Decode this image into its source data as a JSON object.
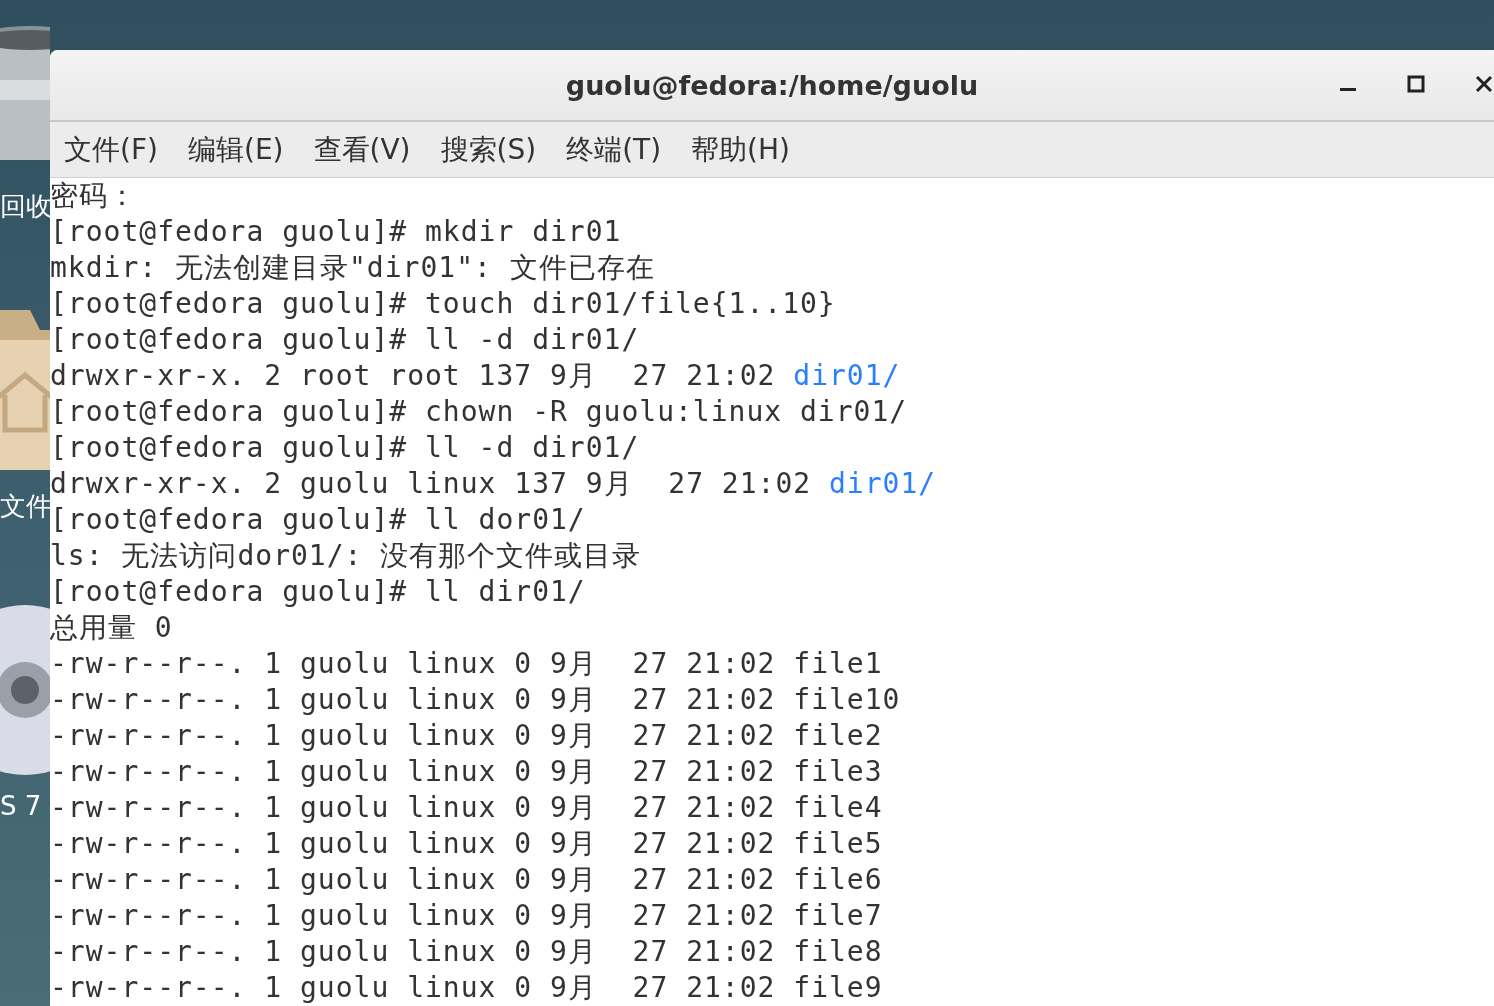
{
  "desktop": {
    "icons": [
      {
        "kind": "trash",
        "label": "回收"
      },
      {
        "kind": "home",
        "label": "文件"
      },
      {
        "kind": "disc",
        "label": "S 7"
      }
    ]
  },
  "window": {
    "title": "guolu@fedora:/home/guolu"
  },
  "menu": [
    "文件(F)",
    "编辑(E)",
    "查看(V)",
    "搜索(S)",
    "终端(T)",
    "帮助(H)"
  ],
  "terminal": {
    "lines": [
      [
        {
          "text": "密码：",
          "kind": "plain"
        }
      ],
      [
        {
          "text": "[root@fedora guolu]# mkdir dir01",
          "kind": "plain"
        }
      ],
      [
        {
          "text": "mkdir: 无法创建目录\"dir01\": 文件已存在",
          "kind": "plain"
        }
      ],
      [
        {
          "text": "[root@fedora guolu]# touch dir01/file{1..10}",
          "kind": "plain"
        }
      ],
      [
        {
          "text": "[root@fedora guolu]# ll -d dir01/",
          "kind": "plain"
        }
      ],
      [
        {
          "text": "drwxr-xr-x. 2 root root 137 9月  27 21:02 ",
          "kind": "plain"
        },
        {
          "text": "dir01/",
          "kind": "dir"
        }
      ],
      [
        {
          "text": "[root@fedora guolu]# chown -R guolu:linux dir01/",
          "kind": "plain"
        }
      ],
      [
        {
          "text": "[root@fedora guolu]# ll -d dir01/",
          "kind": "plain"
        }
      ],
      [
        {
          "text": "drwxr-xr-x. 2 guolu linux 137 9月  27 21:02 ",
          "kind": "plain"
        },
        {
          "text": "dir01/",
          "kind": "dir"
        }
      ],
      [
        {
          "text": "[root@fedora guolu]# ll dor01/",
          "kind": "plain"
        }
      ],
      [
        {
          "text": "ls: 无法访问dor01/: 没有那个文件或目录",
          "kind": "plain"
        }
      ],
      [
        {
          "text": "[root@fedora guolu]# ll dir01/",
          "kind": "plain"
        }
      ],
      [
        {
          "text": "总用量 0",
          "kind": "plain"
        }
      ],
      [
        {
          "text": "-rw-r--r--. 1 guolu linux 0 9月  27 21:02 file1",
          "kind": "plain"
        }
      ],
      [
        {
          "text": "-rw-r--r--. 1 guolu linux 0 9月  27 21:02 file10",
          "kind": "plain"
        }
      ],
      [
        {
          "text": "-rw-r--r--. 1 guolu linux 0 9月  27 21:02 file2",
          "kind": "plain"
        }
      ],
      [
        {
          "text": "-rw-r--r--. 1 guolu linux 0 9月  27 21:02 file3",
          "kind": "plain"
        }
      ],
      [
        {
          "text": "-rw-r--r--. 1 guolu linux 0 9月  27 21:02 file4",
          "kind": "plain"
        }
      ],
      [
        {
          "text": "-rw-r--r--. 1 guolu linux 0 9月  27 21:02 file5",
          "kind": "plain"
        }
      ],
      [
        {
          "text": "-rw-r--r--. 1 guolu linux 0 9月  27 21:02 file6",
          "kind": "plain"
        }
      ],
      [
        {
          "text": "-rw-r--r--. 1 guolu linux 0 9月  27 21:02 file7",
          "kind": "plain"
        }
      ],
      [
        {
          "text": "-rw-r--r--. 1 guolu linux 0 9月  27 21:02 file8",
          "kind": "plain"
        }
      ],
      [
        {
          "text": "-rw-r--r--. 1 guolu linux 0 9月  27 21:02 file9",
          "kind": "plain"
        }
      ]
    ]
  }
}
